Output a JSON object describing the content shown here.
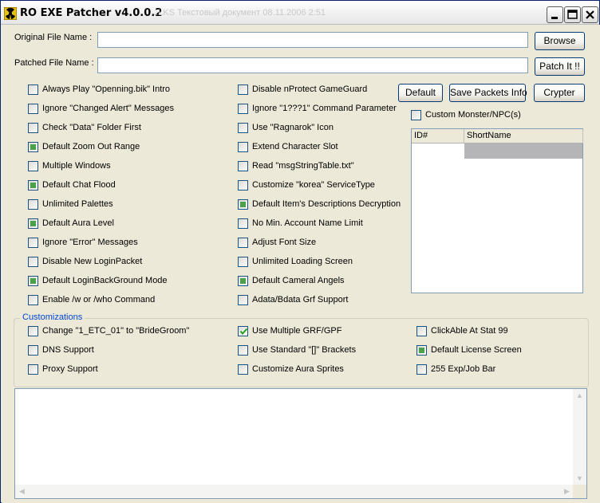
{
  "window": {
    "title": "RO EXE Patcher v4.0.0.2",
    "ghost_text": "...LKS  Текстовый документ  08.11.2006 2:51"
  },
  "files": {
    "original_label": "Original File Name  :",
    "original_value": "",
    "patched_label": "Patched File Name :",
    "patched_value": "",
    "browse_label": "Browse",
    "patch_label": "Patch It !!"
  },
  "actions": {
    "default_label": "Default",
    "save_packets_label": "Save Packets Info",
    "crypter_label": "Crypter"
  },
  "options_col1": [
    {
      "label": "Always Play \"Openning.bik\" Intro",
      "state": "off"
    },
    {
      "label": "Ignore \"Changed Alert\" Messages",
      "state": "off"
    },
    {
      "label": "Check \"Data\" Folder First",
      "state": "off"
    },
    {
      "label": "Default Zoom Out Range",
      "state": "partial"
    },
    {
      "label": "Multiple Windows",
      "state": "off"
    },
    {
      "label": "Default Chat Flood",
      "state": "partial"
    },
    {
      "label": "Unlimited Palettes",
      "state": "off"
    },
    {
      "label": "Default Aura Level",
      "state": "partial"
    },
    {
      "label": "Ignore \"Error\" Messages",
      "state": "off"
    },
    {
      "label": "Disable New LoginPacket",
      "state": "off"
    },
    {
      "label": "Default LoginBackGround Mode",
      "state": "partial"
    },
    {
      "label": "Enable /w or /who  Command",
      "state": "off"
    }
  ],
  "options_col2": [
    {
      "label": "Disable nProtect GameGuard",
      "state": "off"
    },
    {
      "label": "Ignore \"1???1\" Command Parameter",
      "state": "off"
    },
    {
      "label": "Use \"Ragnarok\" Icon",
      "state": "off"
    },
    {
      "label": "Extend Character Slot",
      "state": "off"
    },
    {
      "label": "Read \"msgStringTable.txt\"",
      "state": "off"
    },
    {
      "label": "Customize \"korea\" ServiceType",
      "state": "off"
    },
    {
      "label": "Default Item's Descriptions Decryption",
      "state": "partial"
    },
    {
      "label": "No Min. Account Name Limit",
      "state": "off"
    },
    {
      "label": "Adjust Font Size",
      "state": "off"
    },
    {
      "label": "Unlimited Loading Screen",
      "state": "off"
    },
    {
      "label": "Default Cameral Angels",
      "state": "partial"
    },
    {
      "label": "Adata/Bdata Grf Support",
      "state": "off"
    }
  ],
  "custom_npc": {
    "label": "Custom Monster/NPC(s)",
    "state": "off",
    "columns": [
      "ID#",
      "ShortName"
    ]
  },
  "customizations": {
    "legend": "Customizations",
    "items": [
      {
        "label": "Change \"1_ETC_01\" to \"BrideGroom\"",
        "state": "off"
      },
      {
        "label": "Use Multiple GRF/GPF",
        "state": "checked"
      },
      {
        "label": "ClickAble At Stat 99",
        "state": "off"
      },
      {
        "label": "DNS Support",
        "state": "off"
      },
      {
        "label": "Use Standard \"[]\" Brackets",
        "state": "off"
      },
      {
        "label": "Default License Screen",
        "state": "partial"
      },
      {
        "label": "Proxy Support",
        "state": "off"
      },
      {
        "label": "Customize Aura Sprites",
        "state": "off"
      },
      {
        "label": "255 Exp/Job Bar",
        "state": "off"
      }
    ]
  },
  "log": {
    "text": ""
  },
  "colors": {
    "accent_check": "#4ba04b",
    "legend": "#0046d5"
  }
}
